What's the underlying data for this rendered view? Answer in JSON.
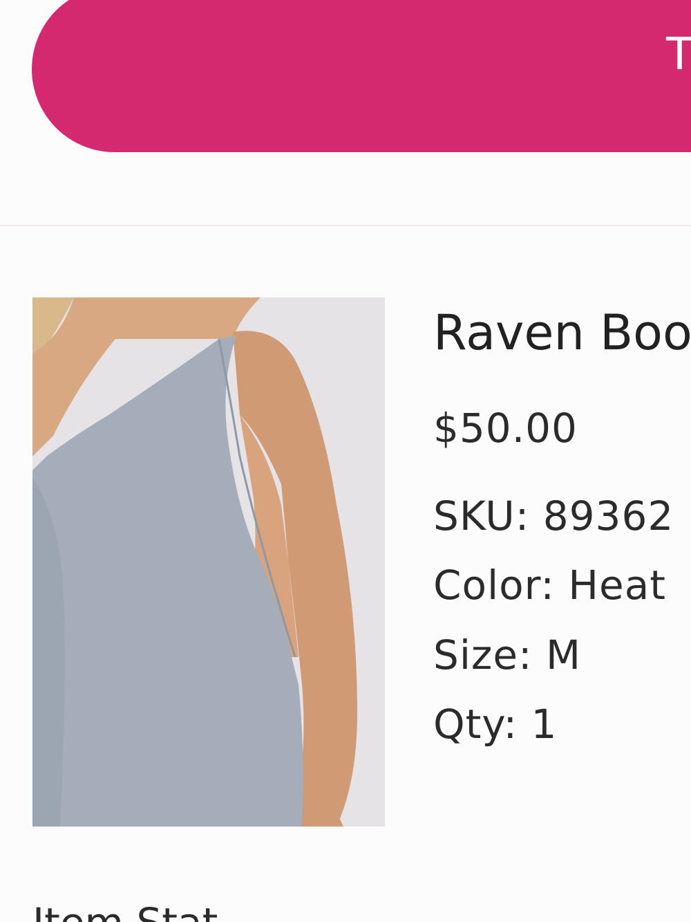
{
  "cta": {
    "label": "T"
  },
  "product": {
    "name": "Raven Boo",
    "price": "$50.00",
    "sku_label": "SKU:",
    "sku_value": "89362",
    "color_label": "Color:",
    "color_value": "Heat",
    "size_label": "Size:",
    "size_value": "M",
    "qty_label": "Qty:",
    "qty_value": "1",
    "image_alt": "product-photo"
  },
  "section": {
    "title": "Item Stat"
  },
  "colors": {
    "accent": "#d4286f",
    "background": "#fcfcfc",
    "text": "#2b2b2b",
    "divider": "#ece8e6"
  }
}
